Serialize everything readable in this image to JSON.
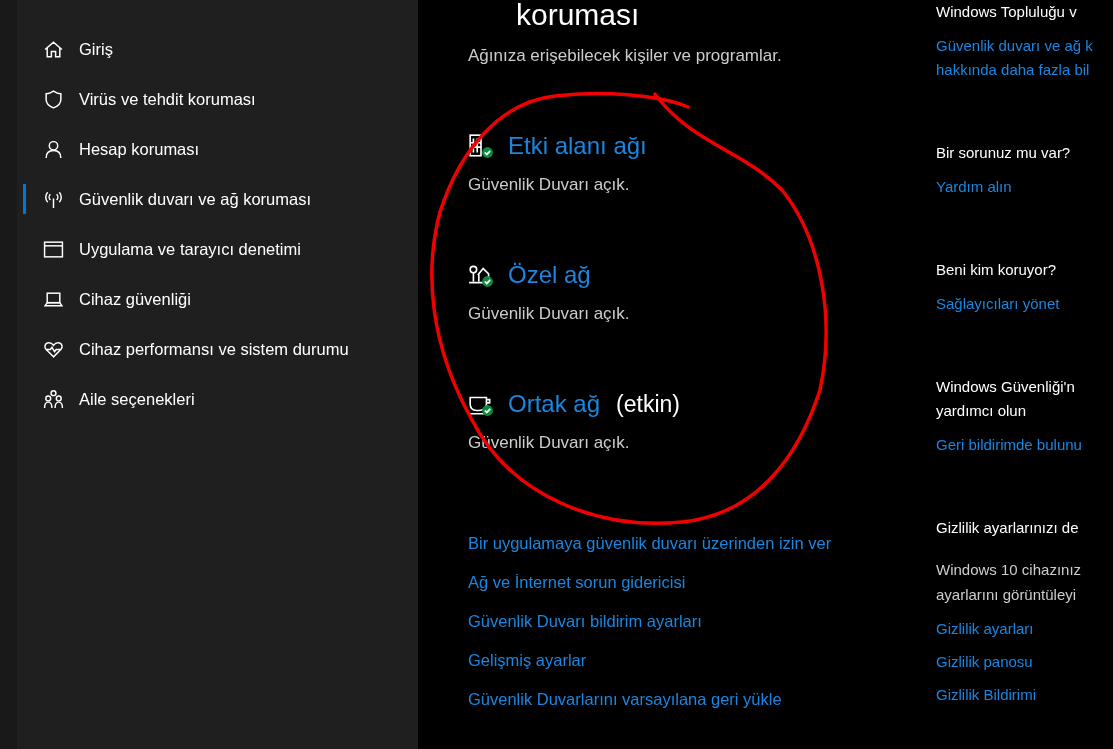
{
  "sidebar": {
    "items": [
      {
        "label": "Giriş",
        "selected": false
      },
      {
        "label": "Virüs ve tehdit koruması",
        "selected": false
      },
      {
        "label": "Hesap koruması",
        "selected": false
      },
      {
        "label": "Güvenlik duvarı ve ağ koruması",
        "selected": true
      },
      {
        "label": "Uygulama ve tarayıcı denetimi",
        "selected": false
      },
      {
        "label": "Cihaz güvenliği",
        "selected": false
      },
      {
        "label": "Cihaz performansı ve sistem durumu",
        "selected": false
      },
      {
        "label": "Aile seçenekleri",
        "selected": false
      }
    ]
  },
  "main": {
    "title": "koruması",
    "subtitle": "Ağınıza erişebilecek kişiler ve programlar.",
    "networks": [
      {
        "name": "Etki alanı ağı",
        "status": "Güvenlik Duvarı açık."
      },
      {
        "name": "Özel ağ",
        "status": "Güvenlik Duvarı açık."
      },
      {
        "name": "Ortak ağ",
        "badge": "(etkin)",
        "status": "Güvenlik Duvarı açık."
      }
    ],
    "links": [
      "Bir uygulamaya güvenlik duvarı üzerinden izin ver",
      "Ağ ve İnternet sorun gidericisi",
      "Güvenlik Duvarı bildirim ayarları",
      "Gelişmiş ayarlar",
      "Güvenlik Duvarlarını varsayılana geri yükle"
    ]
  },
  "aside": {
    "sections": [
      {
        "heading": [
          "Windows Topluluğu v"
        ],
        "links": [
          "Güvenlik duvarı ve ağ k",
          "hakkında daha fazla bil"
        ]
      },
      {
        "heading": [
          "Bir sorunuz mu var?"
        ],
        "links": [
          "Yardım alın"
        ]
      },
      {
        "heading": [
          "Beni kim koruyor?"
        ],
        "links": [
          "Sağlayıcıları yönet"
        ]
      },
      {
        "heading": [
          "Windows Güvenliği'n",
          "yardımcı olun"
        ],
        "links": [
          "Geri bildirimde bulunu"
        ]
      },
      {
        "heading": [
          "Gizlilik ayarlarınızı de"
        ],
        "text": [
          "Windows 10 cihazınız",
          "ayarlarını görüntüleyi"
        ],
        "links": [
          "Gizlilik ayarları",
          "Gizlilik panosu",
          "Gizlilik Bildirimi"
        ]
      }
    ]
  }
}
